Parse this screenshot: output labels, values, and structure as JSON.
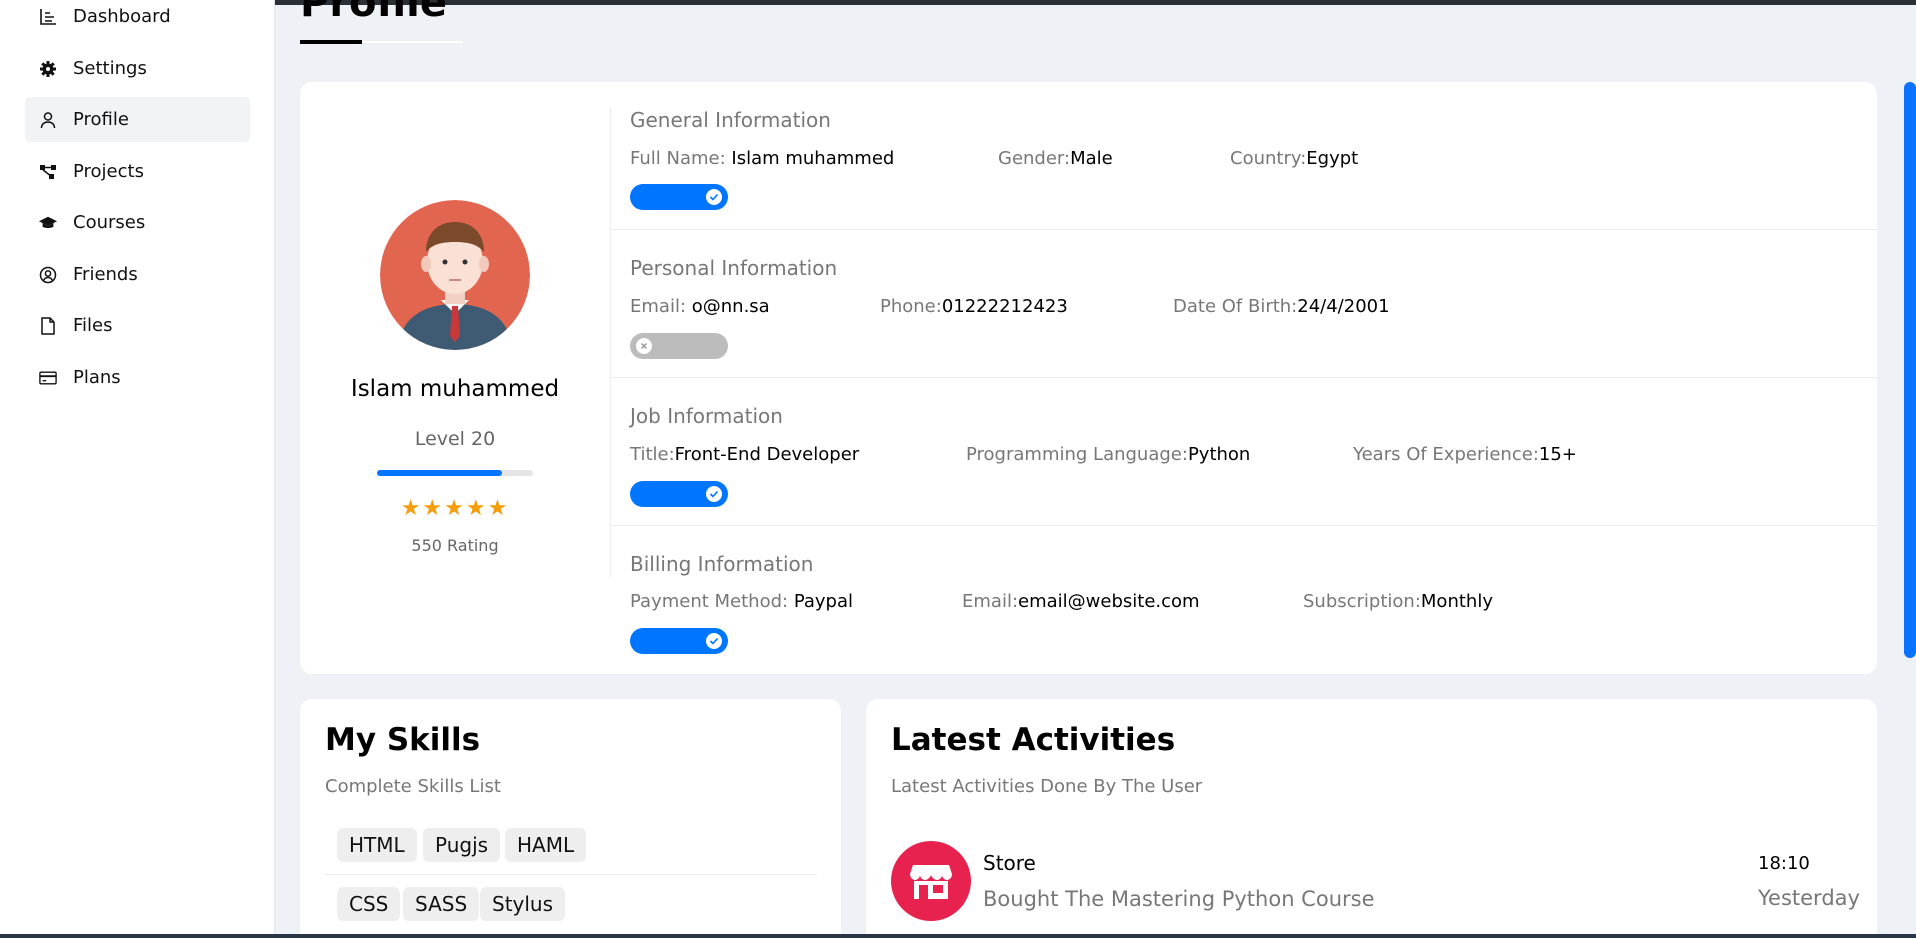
{
  "page": {
    "title": "Profile"
  },
  "sidebar": {
    "items": [
      {
        "label": "Dashboard",
        "icon": "chart-icon",
        "active": false
      },
      {
        "label": "Settings",
        "icon": "gear-icon",
        "active": false
      },
      {
        "label": "Profile",
        "icon": "user-icon",
        "active": true
      },
      {
        "label": "Projects",
        "icon": "diagram-icon",
        "active": false
      },
      {
        "label": "Courses",
        "icon": "graduation-cap-icon",
        "active": false
      },
      {
        "label": "Friends",
        "icon": "user-circle-icon",
        "active": false
      },
      {
        "label": "Files",
        "icon": "file-icon",
        "active": false
      },
      {
        "label": "Plans",
        "icon": "credit-card-icon",
        "active": false
      }
    ]
  },
  "profile": {
    "name": "Islam muhammed",
    "level": "Level 20",
    "level_progress": 0.8,
    "stars": "★★★★★",
    "rating": "550 Rating"
  },
  "sections": {
    "general": {
      "title": "General Information",
      "full_name_label": "Full Name: ",
      "full_name": "Islam muhammed",
      "gender_label": "Gender:",
      "gender": "Male",
      "country_label": "Country:",
      "country": "Egypt",
      "toggle_on": true
    },
    "personal": {
      "title": "Personal Information",
      "email_label": "Email: ",
      "email": "o@nn.sa",
      "phone_label": "Phone:",
      "phone": "01222212423",
      "dob_label": "Date Of Birth:",
      "dob": "24/4/2001",
      "toggle_on": false
    },
    "job": {
      "title": "Job Information",
      "title_label": "Title:",
      "job_title": "Front-End Developer",
      "lang_label": "Programming Language:",
      "lang": "Python",
      "exp_label": "Years Of Experience:",
      "exp": "15+",
      "toggle_on": true
    },
    "billing": {
      "title": "Billing Information",
      "method_label": "Payment Method: ",
      "method": "Paypal",
      "email_label": "Email:",
      "email": "email@website.com",
      "sub_label": "Subscription:",
      "sub": "Monthly",
      "toggle_on": true
    }
  },
  "skills": {
    "title": "My Skills",
    "subtitle": "Complete Skills List",
    "row1": [
      "HTML",
      "Pugjs",
      "HAML"
    ],
    "row2": [
      "CSS",
      "SASS",
      "Stylus"
    ]
  },
  "activities": {
    "title": "Latest Activities",
    "subtitle": "Latest Activities Done By The User",
    "items": [
      {
        "title": "Store",
        "desc": "Bought The Mastering Python Course",
        "time": "18:10",
        "day": "Yesterday",
        "icon": "store-icon"
      }
    ]
  },
  "colors": {
    "accent": "#0075ff",
    "star": "#f59e0b",
    "activity_icon": "#e8224f",
    "toggle_off": "#bcbcbc"
  }
}
